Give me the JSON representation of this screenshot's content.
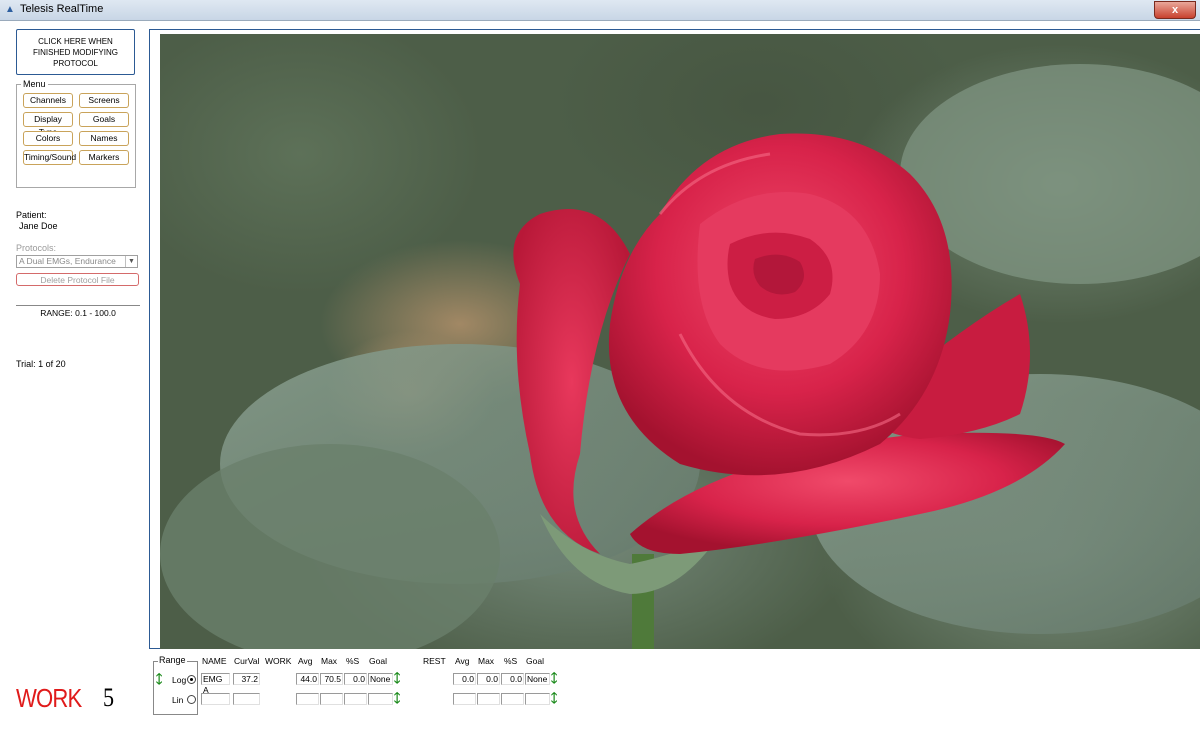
{
  "window": {
    "title": "Telesis RealTime",
    "close_label": "x"
  },
  "left_panel": {
    "finish_button": "CLICK HERE WHEN FINISHED MODIFYING PROTOCOL",
    "menu": {
      "legend": "Menu",
      "buttons": [
        "Channels",
        "Screens",
        "Display Type",
        "Goals",
        "Colors",
        "Names",
        "Timing/Sound",
        "Markers"
      ]
    },
    "patient_label": "Patient:",
    "patient_name": "Jane Doe",
    "protocols_label": "Protocols:",
    "protocol_selected": "A Dual EMGs, Endurance",
    "delete_button": "Delete Protocol File",
    "range": "RANGE: 0.1 - 100.0",
    "trial": "Trial:  1  of  20",
    "phase": "WORK",
    "phase_count": "5"
  },
  "channel_table": {
    "range_legend": "Range",
    "log_label": "Log",
    "lin_label": "Lin",
    "scale_selected": "Log",
    "headers": [
      "NAME",
      "CurVal",
      "WORK",
      "Avg",
      "Max",
      "%S",
      "Goal",
      "REST",
      "Avg",
      "Max",
      "%S",
      "Goal"
    ],
    "rows": [
      {
        "name": "EMG A",
        "curval": "37.2",
        "work_avg": "44.0",
        "work_max": "70.5",
        "work_pct": "0.0",
        "work_goal": "None",
        "rest_avg": "0.0",
        "rest_max": "0.0",
        "rest_pct": "0.0",
        "rest_goal": "None"
      },
      {
        "name": "",
        "curval": "",
        "work_avg": "",
        "work_max": "",
        "work_pct": "",
        "work_goal": "",
        "rest_avg": "",
        "rest_max": "",
        "rest_pct": "",
        "rest_goal": ""
      }
    ]
  },
  "icons": {
    "up": "green-up-arrow-icon",
    "down": "red-down-arrow-icon"
  },
  "colors": {
    "work": "#e01b1b",
    "accent": "#2c5a94",
    "up_arrow": "#1a8a1a",
    "down_arrow": "#d01a1a"
  }
}
